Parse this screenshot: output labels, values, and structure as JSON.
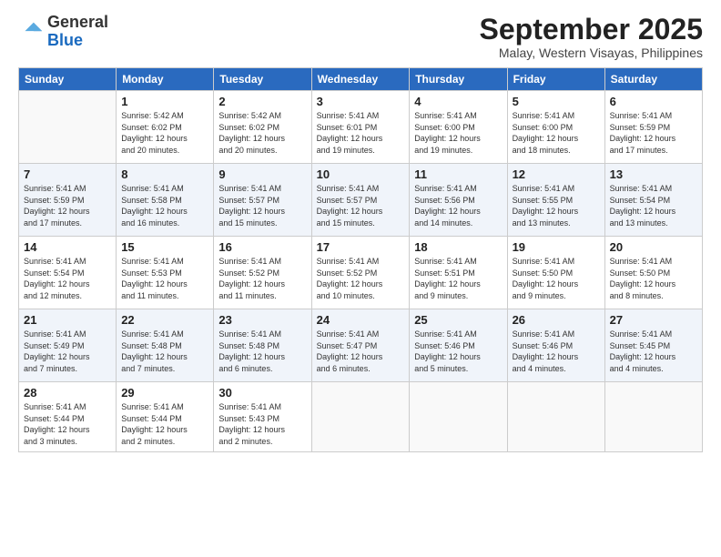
{
  "logo": {
    "general": "General",
    "blue": "Blue"
  },
  "header": {
    "month": "September 2025",
    "location": "Malay, Western Visayas, Philippines"
  },
  "weekdays": [
    "Sunday",
    "Monday",
    "Tuesday",
    "Wednesday",
    "Thursday",
    "Friday",
    "Saturday"
  ],
  "weeks": [
    [
      {
        "day": "",
        "info": ""
      },
      {
        "day": "1",
        "info": "Sunrise: 5:42 AM\nSunset: 6:02 PM\nDaylight: 12 hours\nand 20 minutes."
      },
      {
        "day": "2",
        "info": "Sunrise: 5:42 AM\nSunset: 6:02 PM\nDaylight: 12 hours\nand 20 minutes."
      },
      {
        "day": "3",
        "info": "Sunrise: 5:41 AM\nSunset: 6:01 PM\nDaylight: 12 hours\nand 19 minutes."
      },
      {
        "day": "4",
        "info": "Sunrise: 5:41 AM\nSunset: 6:00 PM\nDaylight: 12 hours\nand 19 minutes."
      },
      {
        "day": "5",
        "info": "Sunrise: 5:41 AM\nSunset: 6:00 PM\nDaylight: 12 hours\nand 18 minutes."
      },
      {
        "day": "6",
        "info": "Sunrise: 5:41 AM\nSunset: 5:59 PM\nDaylight: 12 hours\nand 17 minutes."
      }
    ],
    [
      {
        "day": "7",
        "info": "Sunrise: 5:41 AM\nSunset: 5:59 PM\nDaylight: 12 hours\nand 17 minutes."
      },
      {
        "day": "8",
        "info": "Sunrise: 5:41 AM\nSunset: 5:58 PM\nDaylight: 12 hours\nand 16 minutes."
      },
      {
        "day": "9",
        "info": "Sunrise: 5:41 AM\nSunset: 5:57 PM\nDaylight: 12 hours\nand 15 minutes."
      },
      {
        "day": "10",
        "info": "Sunrise: 5:41 AM\nSunset: 5:57 PM\nDaylight: 12 hours\nand 15 minutes."
      },
      {
        "day": "11",
        "info": "Sunrise: 5:41 AM\nSunset: 5:56 PM\nDaylight: 12 hours\nand 14 minutes."
      },
      {
        "day": "12",
        "info": "Sunrise: 5:41 AM\nSunset: 5:55 PM\nDaylight: 12 hours\nand 13 minutes."
      },
      {
        "day": "13",
        "info": "Sunrise: 5:41 AM\nSunset: 5:54 PM\nDaylight: 12 hours\nand 13 minutes."
      }
    ],
    [
      {
        "day": "14",
        "info": "Sunrise: 5:41 AM\nSunset: 5:54 PM\nDaylight: 12 hours\nand 12 minutes."
      },
      {
        "day": "15",
        "info": "Sunrise: 5:41 AM\nSunset: 5:53 PM\nDaylight: 12 hours\nand 11 minutes."
      },
      {
        "day": "16",
        "info": "Sunrise: 5:41 AM\nSunset: 5:52 PM\nDaylight: 12 hours\nand 11 minutes."
      },
      {
        "day": "17",
        "info": "Sunrise: 5:41 AM\nSunset: 5:52 PM\nDaylight: 12 hours\nand 10 minutes."
      },
      {
        "day": "18",
        "info": "Sunrise: 5:41 AM\nSunset: 5:51 PM\nDaylight: 12 hours\nand 9 minutes."
      },
      {
        "day": "19",
        "info": "Sunrise: 5:41 AM\nSunset: 5:50 PM\nDaylight: 12 hours\nand 9 minutes."
      },
      {
        "day": "20",
        "info": "Sunrise: 5:41 AM\nSunset: 5:50 PM\nDaylight: 12 hours\nand 8 minutes."
      }
    ],
    [
      {
        "day": "21",
        "info": "Sunrise: 5:41 AM\nSunset: 5:49 PM\nDaylight: 12 hours\nand 7 minutes."
      },
      {
        "day": "22",
        "info": "Sunrise: 5:41 AM\nSunset: 5:48 PM\nDaylight: 12 hours\nand 7 minutes."
      },
      {
        "day": "23",
        "info": "Sunrise: 5:41 AM\nSunset: 5:48 PM\nDaylight: 12 hours\nand 6 minutes."
      },
      {
        "day": "24",
        "info": "Sunrise: 5:41 AM\nSunset: 5:47 PM\nDaylight: 12 hours\nand 6 minutes."
      },
      {
        "day": "25",
        "info": "Sunrise: 5:41 AM\nSunset: 5:46 PM\nDaylight: 12 hours\nand 5 minutes."
      },
      {
        "day": "26",
        "info": "Sunrise: 5:41 AM\nSunset: 5:46 PM\nDaylight: 12 hours\nand 4 minutes."
      },
      {
        "day": "27",
        "info": "Sunrise: 5:41 AM\nSunset: 5:45 PM\nDaylight: 12 hours\nand 4 minutes."
      }
    ],
    [
      {
        "day": "28",
        "info": "Sunrise: 5:41 AM\nSunset: 5:44 PM\nDaylight: 12 hours\nand 3 minutes."
      },
      {
        "day": "29",
        "info": "Sunrise: 5:41 AM\nSunset: 5:44 PM\nDaylight: 12 hours\nand 2 minutes."
      },
      {
        "day": "30",
        "info": "Sunrise: 5:41 AM\nSunset: 5:43 PM\nDaylight: 12 hours\nand 2 minutes."
      },
      {
        "day": "",
        "info": ""
      },
      {
        "day": "",
        "info": ""
      },
      {
        "day": "",
        "info": ""
      },
      {
        "day": "",
        "info": ""
      }
    ]
  ]
}
